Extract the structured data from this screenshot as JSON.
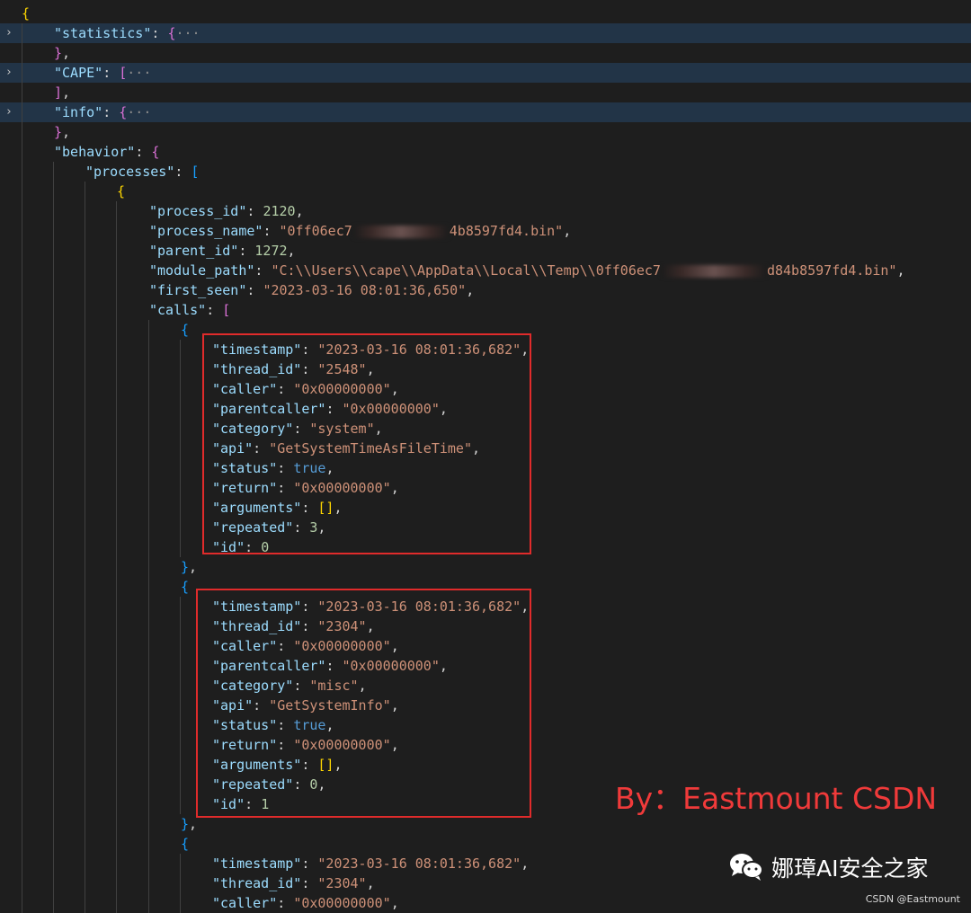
{
  "editor": {
    "lines": [
      [
        [
          "br1",
          "{"
        ]
      ],
      [
        [
          "k",
          "\"statistics\""
        ],
        [
          "p",
          ": "
        ],
        [
          "br2",
          "{"
        ],
        [
          "d",
          "···"
        ]
      ],
      [
        [
          "br2",
          "}"
        ],
        [
          "p",
          ","
        ]
      ],
      [
        [
          "k",
          "\"CAPE\""
        ],
        [
          "p",
          ": "
        ],
        [
          "br2",
          "["
        ],
        [
          "d",
          "···"
        ]
      ],
      [
        [
          "br2",
          "]"
        ],
        [
          "p",
          ","
        ]
      ],
      [
        [
          "k",
          "\"info\""
        ],
        [
          "p",
          ": "
        ],
        [
          "br2",
          "{"
        ],
        [
          "d",
          "···"
        ]
      ],
      [
        [
          "br2",
          "}"
        ],
        [
          "p",
          ","
        ]
      ],
      [
        [
          "k",
          "\"behavior\""
        ],
        [
          "p",
          ": "
        ],
        [
          "br2",
          "{"
        ]
      ],
      [
        [
          "k",
          "\"processes\""
        ],
        [
          "p",
          ": "
        ],
        [
          "br3",
          "["
        ]
      ],
      [
        [
          "br1",
          "{"
        ]
      ],
      [
        [
          "k",
          "\"process_id\""
        ],
        [
          "p",
          ": "
        ],
        [
          "n",
          "2120"
        ],
        [
          "p",
          ","
        ]
      ],
      [
        [
          "k",
          "\"process_name\""
        ],
        [
          "p",
          ": "
        ],
        [
          "s",
          "\"0ff06ec7"
        ],
        [
          "redact",
          ""
        ],
        [
          "s",
          "4b8597fd4.bin\""
        ],
        [
          "p",
          ","
        ]
      ],
      [
        [
          "k",
          "\"parent_id\""
        ],
        [
          "p",
          ": "
        ],
        [
          "n",
          "1272"
        ],
        [
          "p",
          ","
        ]
      ],
      [
        [
          "k",
          "\"module_path\""
        ],
        [
          "p",
          ": "
        ],
        [
          "s",
          "\"C:\\\\Users\\\\cape\\\\AppData\\\\Local\\\\Temp\\\\0ff06ec7"
        ],
        [
          "redact-wide",
          ""
        ],
        [
          "s",
          "d84b8597fd4.bin\""
        ],
        [
          "p",
          ","
        ]
      ],
      [
        [
          "k",
          "\"first_seen\""
        ],
        [
          "p",
          ": "
        ],
        [
          "s",
          "\"2023-03-16 08:01:36,650\""
        ],
        [
          "p",
          ","
        ]
      ],
      [
        [
          "k",
          "\"calls\""
        ],
        [
          "p",
          ": "
        ],
        [
          "br2",
          "["
        ]
      ],
      [
        [
          "br3",
          "{"
        ]
      ],
      [
        [
          "k",
          "\"timestamp\""
        ],
        [
          "p",
          ": "
        ],
        [
          "s",
          "\"2023-03-16 08:01:36,682\""
        ],
        [
          "p",
          ","
        ]
      ],
      [
        [
          "k",
          "\"thread_id\""
        ],
        [
          "p",
          ": "
        ],
        [
          "s",
          "\"2548\""
        ],
        [
          "p",
          ","
        ]
      ],
      [
        [
          "k",
          "\"caller\""
        ],
        [
          "p",
          ": "
        ],
        [
          "s",
          "\"0x00000000\""
        ],
        [
          "p",
          ","
        ]
      ],
      [
        [
          "k",
          "\"parentcaller\""
        ],
        [
          "p",
          ": "
        ],
        [
          "s",
          "\"0x00000000\""
        ],
        [
          "p",
          ","
        ]
      ],
      [
        [
          "k",
          "\"category\""
        ],
        [
          "p",
          ": "
        ],
        [
          "s",
          "\"system\""
        ],
        [
          "p",
          ","
        ]
      ],
      [
        [
          "k",
          "\"api\""
        ],
        [
          "p",
          ": "
        ],
        [
          "s",
          "\"GetSystemTimeAsFileTime\""
        ],
        [
          "p",
          ","
        ]
      ],
      [
        [
          "k",
          "\"status\""
        ],
        [
          "p",
          ": "
        ],
        [
          "b",
          "true"
        ],
        [
          "p",
          ","
        ]
      ],
      [
        [
          "k",
          "\"return\""
        ],
        [
          "p",
          ": "
        ],
        [
          "s",
          "\"0x00000000\""
        ],
        [
          "p",
          ","
        ]
      ],
      [
        [
          "k",
          "\"arguments\""
        ],
        [
          "p",
          ": "
        ],
        [
          "br1",
          "[]"
        ],
        [
          "p",
          ","
        ]
      ],
      [
        [
          "k",
          "\"repeated\""
        ],
        [
          "p",
          ": "
        ],
        [
          "n",
          "3"
        ],
        [
          "p",
          ","
        ]
      ],
      [
        [
          "k",
          "\"id\""
        ],
        [
          "p",
          ": "
        ],
        [
          "n",
          "0"
        ]
      ],
      [
        [
          "br3",
          "}"
        ],
        [
          "p",
          ","
        ]
      ],
      [
        [
          "br3",
          "{"
        ]
      ],
      [
        [
          "k",
          "\"timestamp\""
        ],
        [
          "p",
          ": "
        ],
        [
          "s",
          "\"2023-03-16 08:01:36,682\""
        ],
        [
          "p",
          ","
        ]
      ],
      [
        [
          "k",
          "\"thread_id\""
        ],
        [
          "p",
          ": "
        ],
        [
          "s",
          "\"2304\""
        ],
        [
          "p",
          ","
        ]
      ],
      [
        [
          "k",
          "\"caller\""
        ],
        [
          "p",
          ": "
        ],
        [
          "s",
          "\"0x00000000\""
        ],
        [
          "p",
          ","
        ]
      ],
      [
        [
          "k",
          "\"parentcaller\""
        ],
        [
          "p",
          ": "
        ],
        [
          "s",
          "\"0x00000000\""
        ],
        [
          "p",
          ","
        ]
      ],
      [
        [
          "k",
          "\"category\""
        ],
        [
          "p",
          ": "
        ],
        [
          "s",
          "\"misc\""
        ],
        [
          "p",
          ","
        ]
      ],
      [
        [
          "k",
          "\"api\""
        ],
        [
          "p",
          ": "
        ],
        [
          "s",
          "\"GetSystemInfo\""
        ],
        [
          "p",
          ","
        ]
      ],
      [
        [
          "k",
          "\"status\""
        ],
        [
          "p",
          ": "
        ],
        [
          "b",
          "true"
        ],
        [
          "p",
          ","
        ]
      ],
      [
        [
          "k",
          "\"return\""
        ],
        [
          "p",
          ": "
        ],
        [
          "s",
          "\"0x00000000\""
        ],
        [
          "p",
          ","
        ]
      ],
      [
        [
          "k",
          "\"arguments\""
        ],
        [
          "p",
          ": "
        ],
        [
          "br1",
          "[]"
        ],
        [
          "p",
          ","
        ]
      ],
      [
        [
          "k",
          "\"repeated\""
        ],
        [
          "p",
          ": "
        ],
        [
          "n",
          "0"
        ],
        [
          "p",
          ","
        ]
      ],
      [
        [
          "k",
          "\"id\""
        ],
        [
          "p",
          ": "
        ],
        [
          "n",
          "1"
        ]
      ],
      [
        [
          "br3",
          "}"
        ],
        [
          "p",
          ","
        ]
      ],
      [
        [
          "br3",
          "{"
        ]
      ],
      [
        [
          "k",
          "\"timestamp\""
        ],
        [
          "p",
          ": "
        ],
        [
          "s",
          "\"2023-03-16 08:01:36,682\""
        ],
        [
          "p",
          ","
        ]
      ],
      [
        [
          "k",
          "\"thread_id\""
        ],
        [
          "p",
          ": "
        ],
        [
          "s",
          "\"2304\""
        ],
        [
          "p",
          ","
        ]
      ],
      [
        [
          "k",
          "\"caller\""
        ],
        [
          "p",
          ": "
        ],
        [
          "s",
          "\"0x00000000\""
        ],
        [
          "p",
          ","
        ]
      ]
    ],
    "folded_lines": [
      1,
      3,
      5
    ]
  },
  "overlay": {
    "watermark": "By：Eastmount CSDN",
    "wechat_account": "娜璋AI安全之家",
    "credit": "CSDN @Eastmount"
  },
  "colors": {
    "background": "#1e1e1e",
    "key": "#9cdcfe",
    "string": "#ce9178",
    "number": "#b5cea8",
    "boolean": "#569cd6",
    "highlight_box": "#e02b2b",
    "watermark": "#f03a3a"
  }
}
